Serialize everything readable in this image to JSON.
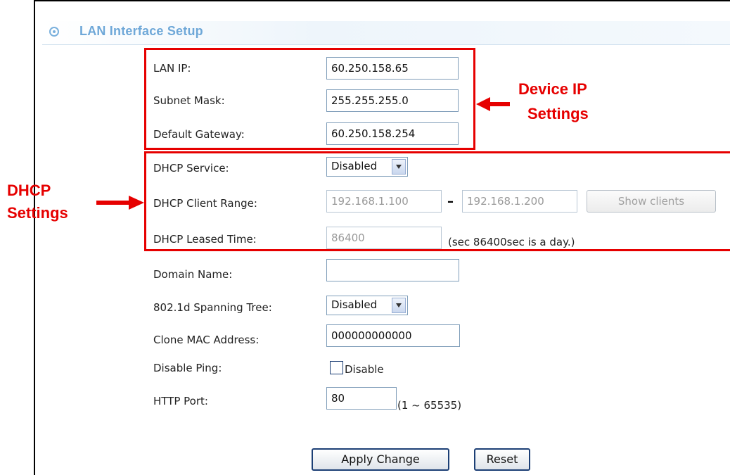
{
  "header": {
    "title": "LAN Interface Setup",
    "icon": "radio-circle-icon"
  },
  "annotations": {
    "device_ip_line1": "Device IP",
    "device_ip_line2": "Settings",
    "dhcp_line1": "DHCP",
    "dhcp_line2": "Settings",
    "color": "#e60000"
  },
  "fields": {
    "lan_ip": {
      "label": "LAN IP:",
      "value": "60.250.158.65"
    },
    "subnet_mask": {
      "label": "Subnet Mask:",
      "value": "255.255.255.0"
    },
    "default_gateway": {
      "label": "Default Gateway:",
      "value": "60.250.158.254"
    },
    "dhcp_service": {
      "label": "DHCP Service:",
      "value": "Disabled"
    },
    "dhcp_client_range": {
      "label": "DHCP Client Range:",
      "start": "192.168.1.100",
      "separator": "–",
      "end": "192.168.1.200",
      "button": "Show clients"
    },
    "dhcp_leased_time": {
      "label": "DHCP Leased Time:",
      "value": "86400",
      "hint": "(sec 86400sec is a day.)"
    },
    "domain_name": {
      "label": "Domain Name:",
      "value": ""
    },
    "spanning_tree": {
      "label": "802.1d Spanning Tree:",
      "value": "Disabled"
    },
    "clone_mac": {
      "label": "Clone MAC Address:",
      "value": "000000000000"
    },
    "disable_ping": {
      "label": "Disable Ping:",
      "checkbox_label": "Disable",
      "checked": false
    },
    "http_port": {
      "label": "HTTP Port:",
      "value": "80",
      "hint": "(1 ~ 65535)"
    }
  },
  "buttons": {
    "apply": "Apply Change",
    "reset": "Reset"
  },
  "colors": {
    "header_title": "#6fa8d8",
    "annotation_red": "#e60000",
    "input_border": "#7f9db9"
  }
}
